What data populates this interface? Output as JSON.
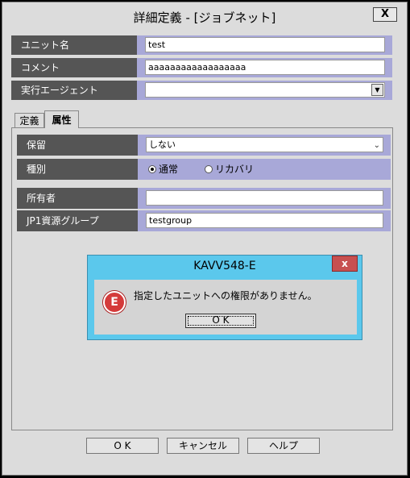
{
  "window": {
    "title": "詳細定義 - [ジョブネット]",
    "close_label": "X"
  },
  "form": {
    "unit_name": {
      "label": "ユニット名",
      "value": "test"
    },
    "comment": {
      "label": "コメント",
      "value": "aaaaaaaaaaaaaaaaaa"
    },
    "agent": {
      "label": "実行エージェント",
      "value": ""
    }
  },
  "tabs": [
    {
      "label": "定義"
    },
    {
      "label": "属性"
    }
  ],
  "attributes": {
    "hold": {
      "label": "保留",
      "value": "しない"
    },
    "type": {
      "label": "種別",
      "options": [
        "通常",
        "リカバリ"
      ],
      "selected": "通常"
    },
    "owner": {
      "label": "所有者",
      "value": ""
    },
    "jp1_group": {
      "label": "JP1資源グループ",
      "value": "testgroup"
    }
  },
  "dialog": {
    "title": "KAVV548-E",
    "close_label": "x",
    "icon_letter": "E",
    "message": "指定したユニットへの権限がありません。",
    "ok_label": "O K"
  },
  "buttons": {
    "ok": "O K",
    "cancel": "キャンセル",
    "help": "ヘルプ"
  },
  "colors": {
    "label_bg": "#555555",
    "row_bg": "#a8a8d8",
    "dialog_title": "#5bc8ec",
    "error": "#d43a3a"
  },
  "icons": [
    "close-icon",
    "dropdown-arrow-icon",
    "chevron-down-icon",
    "error-icon"
  ]
}
